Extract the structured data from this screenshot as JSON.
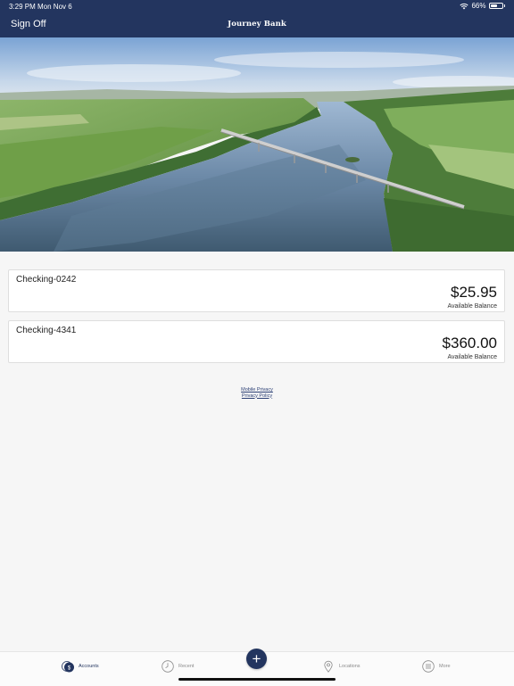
{
  "status_bar": {
    "time": "3:29 PM",
    "date": "Mon Nov 6",
    "battery_percent": "66%",
    "battery_level": 0.66,
    "icons": [
      "wifi-icon",
      "battery-icon"
    ]
  },
  "header": {
    "sign_off_label": "Sign Off",
    "brand": "Journey Bank"
  },
  "hero": {
    "image": "aerial-river-bridge-photo"
  },
  "accounts": [
    {
      "name": "Checking-0242",
      "balance": "$25.95",
      "balance_label": "Available Balance"
    },
    {
      "name": "Checking-4341",
      "balance": "$360.00",
      "balance_label": "Available Balance"
    }
  ],
  "links": {
    "mobile_privacy": "Mobile Privacy",
    "privacy_policy": "Privacy Policy"
  },
  "tabbar": {
    "items": [
      {
        "label": "Accounts",
        "icon": "accounts-icon",
        "active": true
      },
      {
        "label": "Recent",
        "icon": "clock-icon",
        "active": false
      },
      {
        "label": "Locations",
        "icon": "location-pin-icon",
        "active": false
      },
      {
        "label": "More",
        "icon": "menu-icon",
        "active": false
      }
    ],
    "add_icon": "+"
  },
  "colors": {
    "header_bg": "#23355f",
    "page_bg": "#f6f6f6",
    "accent": "#23355f"
  }
}
